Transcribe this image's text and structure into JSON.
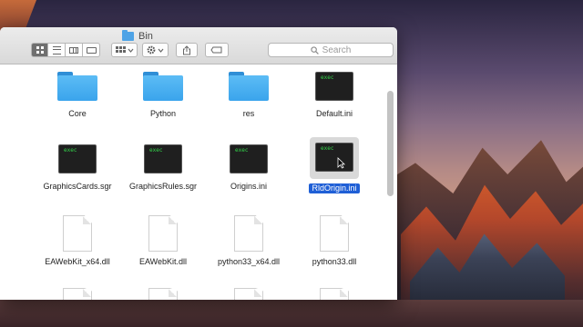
{
  "window": {
    "title": "Bin"
  },
  "toolbar": {
    "view_buttons": [
      "icon-view",
      "list-view",
      "column-view",
      "cover-flow-view"
    ],
    "search_placeholder": "Search"
  },
  "files": [
    {
      "name": "Core",
      "kind": "folder"
    },
    {
      "name": "Python",
      "kind": "folder"
    },
    {
      "name": "res",
      "kind": "folder"
    },
    {
      "name": "Default.ini",
      "kind": "exec"
    },
    {
      "name": "GraphicsCards.sgr",
      "kind": "exec"
    },
    {
      "name": "GraphicsRules.sgr",
      "kind": "exec"
    },
    {
      "name": "Origins.ini",
      "kind": "exec"
    },
    {
      "name": "RldOrigin.ini",
      "kind": "exec",
      "selected": true
    },
    {
      "name": "EAWebKit_x64.dll",
      "kind": "document"
    },
    {
      "name": "EAWebKit.dll",
      "kind": "document"
    },
    {
      "name": "python33_x64.dll",
      "kind": "document"
    },
    {
      "name": "python33.dll",
      "kind": "document"
    }
  ],
  "exec_icon_text": "exec",
  "colors": {
    "selection": "#1f5fd6",
    "folder": "#3aa4ec",
    "exec_text": "#33d44a"
  }
}
